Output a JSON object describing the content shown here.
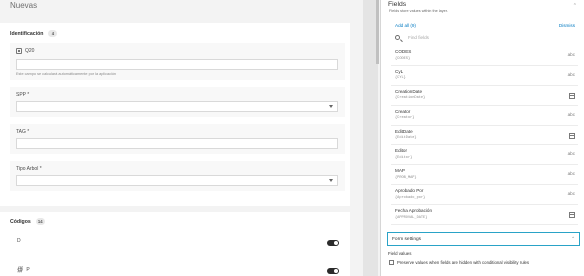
{
  "form": {
    "title": "Nuevas",
    "groups": [
      {
        "title": "Identificación",
        "count": "4",
        "fields": [
          {
            "label": "Q20",
            "hint": "Este campo se calculará automáticamente por la aplicación"
          },
          {
            "label": "SPP *"
          },
          {
            "label": "TAG *"
          },
          {
            "label": "Tipo Arbol *"
          }
        ]
      },
      {
        "title": "Códigos",
        "count": "14",
        "rows": [
          {
            "label": "D"
          },
          {
            "label": "P"
          }
        ]
      }
    ]
  },
  "panel": {
    "title": "Fields",
    "subtitle": "Fields store values within the layer.",
    "add_all": "Add all (9)",
    "dismiss": "Dismiss",
    "search_placeholder": "Find fields",
    "fields": [
      {
        "name": "CODES",
        "expr": "{CODES}",
        "icon": "text-icon",
        "glyph": "abc"
      },
      {
        "name": "CyL",
        "expr": "{CYL}",
        "icon": "text-icon",
        "glyph": "abc"
      },
      {
        "name": "CreationDate",
        "expr": "{CreationDate}",
        "icon": "calendar-icon",
        "glyph": ""
      },
      {
        "name": "Creator",
        "expr": "{Creator}",
        "icon": "text-icon",
        "glyph": "abc"
      },
      {
        "name": "EditDate",
        "expr": "{EditDate}",
        "icon": "calendar-icon",
        "glyph": ""
      },
      {
        "name": "Editor",
        "expr": "{Editor}",
        "icon": "text-icon",
        "glyph": "abc"
      },
      {
        "name": "MAP",
        "expr": "{PROB_MAP}",
        "icon": "text-icon",
        "glyph": "abc"
      },
      {
        "name": "Aprobado Por",
        "expr": "{Aprobado_por}",
        "icon": "text-icon",
        "glyph": "abc"
      },
      {
        "name": "Fecha Aprobación",
        "expr": "{APPROVAL_DATE}",
        "icon": "calendar-icon",
        "glyph": ""
      }
    ],
    "form_settings": "Form settings",
    "field_values_title": "Field values",
    "preserve_label": "Preserve values when fields are hidden with conditional visibility rules"
  }
}
